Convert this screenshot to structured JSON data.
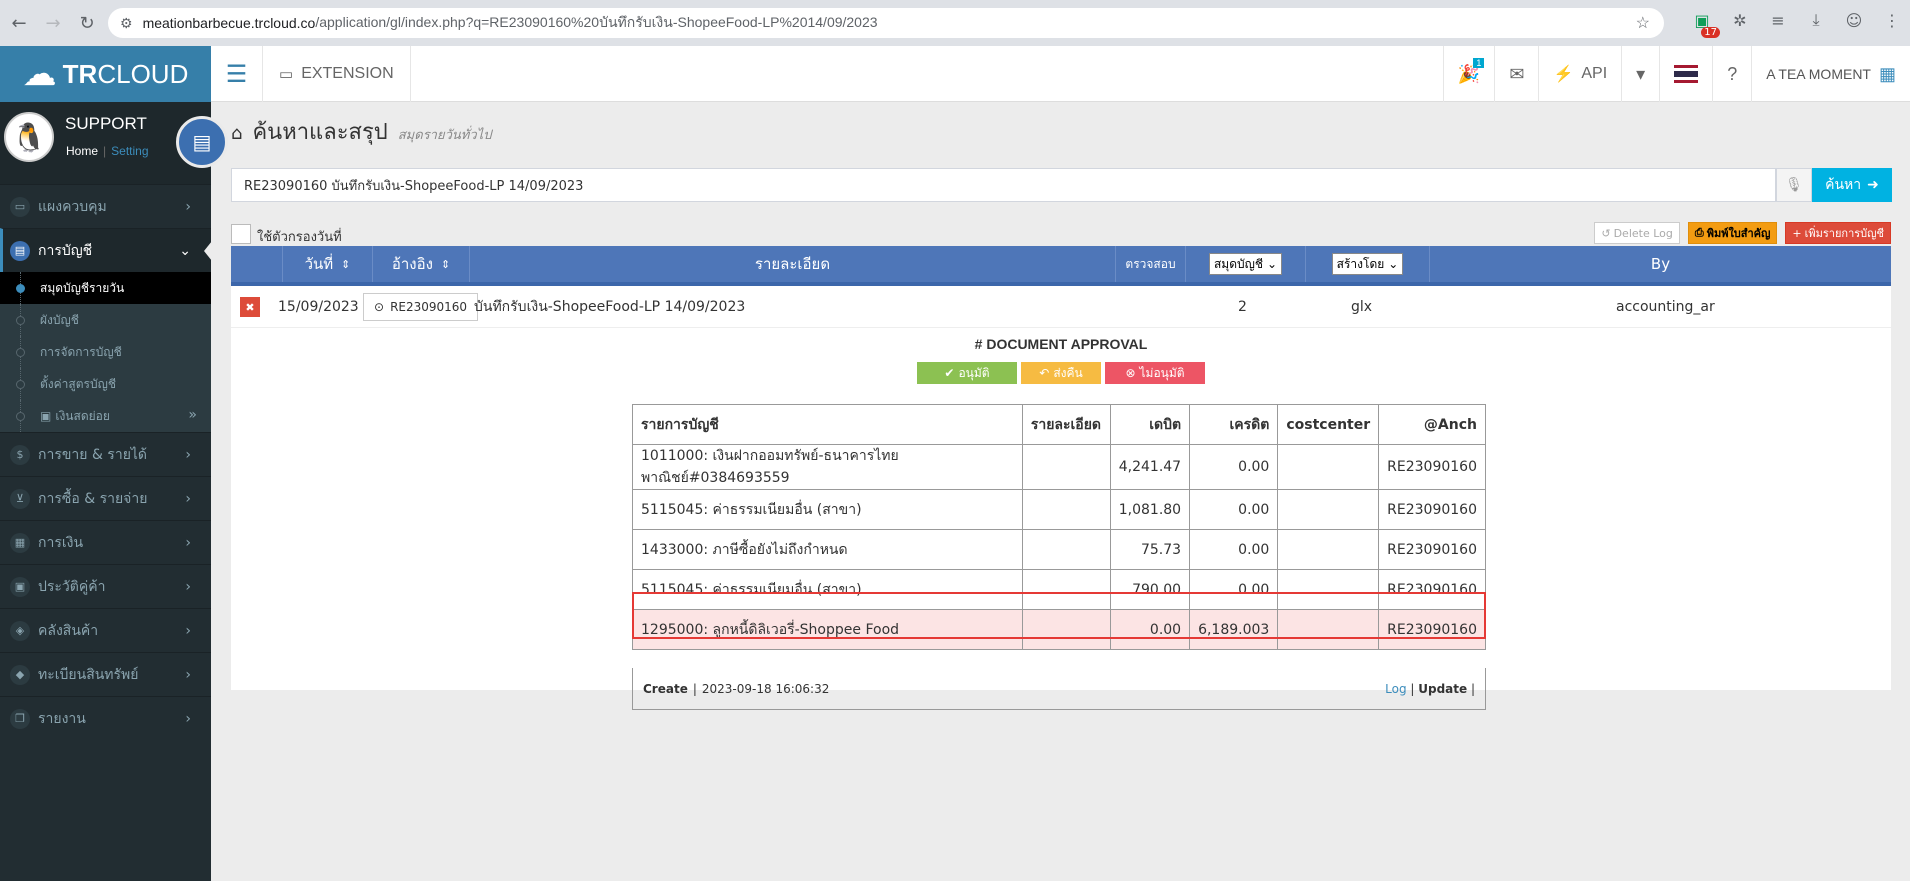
{
  "browser": {
    "url_host": "meationbarbecue.trcloud.co",
    "url_path": "/application/gl/index.php?q=RE23090160%20บันทึกรับเงิน-ShopeeFood-LP%2014/09/2023",
    "ext_badge": "17"
  },
  "header": {
    "logo_bold": "TR",
    "logo_light": "CLOUD",
    "extension_label": "EXTENSION",
    "notif_badge": "1",
    "api_label": "API",
    "company_name": "A TEA MOMENT"
  },
  "user": {
    "name": "SUPPORT",
    "home_link": "Home",
    "setting_link": "Setting"
  },
  "sidebar": {
    "items": [
      {
        "label": "แผงควบคุม"
      },
      {
        "label": "การบัญชี"
      },
      {
        "label": "การขาย & รายได้"
      },
      {
        "label": "การซื้อ & รายจ่าย"
      },
      {
        "label": "การเงิน"
      },
      {
        "label": "ประวัติคู่ค้า"
      },
      {
        "label": "คลังสินค้า"
      },
      {
        "label": "ทะเบียนสินทรัพย์"
      },
      {
        "label": "รายงาน"
      }
    ],
    "sub_items": [
      {
        "label": "สมุดบัญชีรายวัน"
      },
      {
        "label": "ผังบัญชี"
      },
      {
        "label": "การจัดการบัญชี"
      },
      {
        "label": "ตั้งค่าสูตรบัญชี"
      },
      {
        "label": "เงินสดย่อย"
      }
    ]
  },
  "page": {
    "title": "ค้นหาและสรุป",
    "subtitle": "สมุดรายวันทั่วไป"
  },
  "search": {
    "value": "RE23090160 บันทึกรับเงิน-ShopeeFood-LP 14/09/2023",
    "button_label": "ค้นหา"
  },
  "filter": {
    "date_filter_label": "ใช้ตัวกรองวันที่",
    "delete_log_label": "Delete Log",
    "print_label": "พิมพ์ใบสำคัญ",
    "add_label": "เพิ่มรายการบัญชี"
  },
  "table": {
    "headers": {
      "date": "วันที่",
      "ref": "อ้างอิง",
      "detail": "รายละเอียด",
      "check": "ตรวจสอบ",
      "book_select": "สมุดบัญชี",
      "creator_select": "สร้างโดย",
      "by": "By"
    },
    "row": {
      "date": "15/09/2023",
      "ref": "RE23090160",
      "detail": "บันทึกรับเงิน-ShopeeFood-LP 14/09/2023",
      "book": "2",
      "creator": "glx",
      "by": "accounting_ar"
    }
  },
  "approval": {
    "title": "# DOCUMENT APPROVAL",
    "approve_label": "อนุมัติ",
    "return_label": "ส่งคืน",
    "reject_label": "ไม่อนุมัติ"
  },
  "entries": {
    "headers": [
      "รายการบัญชี",
      "รายละเอียด",
      "เดบิต",
      "เครดิต",
      "costcenter",
      "@Anch"
    ],
    "rows": [
      {
        "account": "1011000: เงินฝากออมทรัพย์-ธนาคารไทยพาณิชย์#0384693559",
        "detail": "",
        "debit": "4,241.47",
        "credit": "0.00",
        "costcenter": "",
        "anch": "RE23090160"
      },
      {
        "account": "5115045: ค่าธรรมเนียมอื่น (สาขา)",
        "detail": "",
        "debit": "1,081.80",
        "credit": "0.00",
        "costcenter": "",
        "anch": "RE23090160"
      },
      {
        "account": "1433000: ภาษีซื้อยังไม่ถึงกำหนด",
        "detail": "",
        "debit": "75.73",
        "credit": "0.00",
        "costcenter": "",
        "anch": "RE23090160"
      },
      {
        "account": "5115045: ค่าธรรมเนียมอื่น (สาขา)",
        "detail": "",
        "debit": "790.00",
        "credit": "0.00",
        "costcenter": "",
        "anch": "RE23090160"
      },
      {
        "account": "1295000: ลูกหนี้ดิลิเวอรี่-Shoppee Food",
        "detail": "",
        "debit": "0.00",
        "credit": "6,189.003",
        "costcenter": "",
        "anch": "RE23090160"
      }
    ],
    "footer": {
      "create_label": "Create",
      "created_at": "2023-09-18 16:06:32",
      "log_label": "Log",
      "update_label": "Update"
    }
  },
  "colors": {
    "brand": "#367fa9",
    "table_header": "#4e76b8",
    "highlight_border": "#e53935",
    "highlight_bg": "#fce4e4"
  }
}
